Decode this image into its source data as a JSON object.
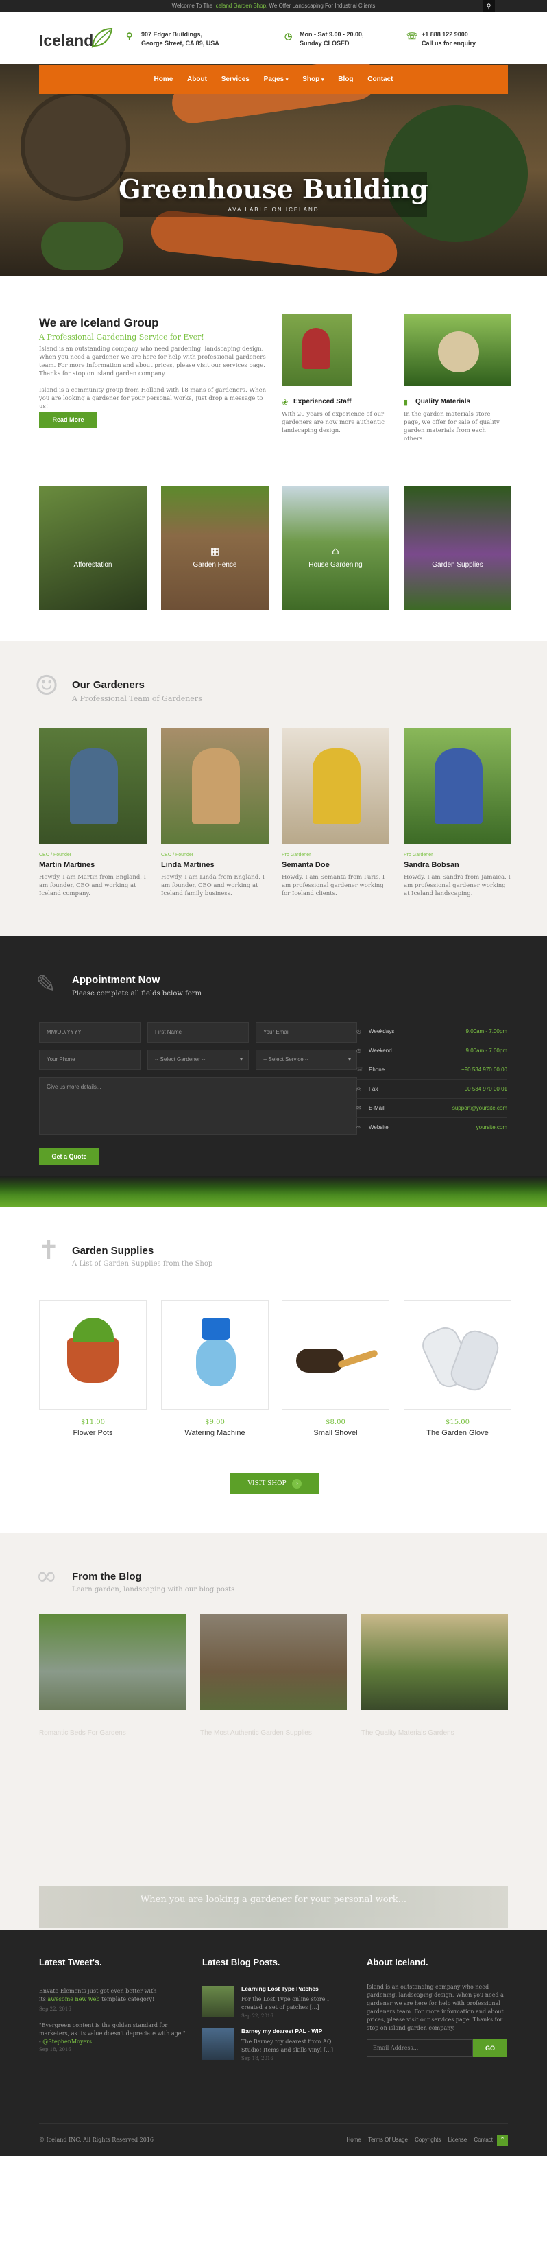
{
  "topbar": {
    "pre": "Welcome To The ",
    "link": "Iceland Garden Shop.",
    "post": " We Offer Landscaping For Industrial Clients",
    "search_icon": "search-icon"
  },
  "header": {
    "logo": "Iceland",
    "address_line1": "907 Edgar Buildings,",
    "address_line2": "George Street, CA 89, USA",
    "hours_line1": "Mon - Sat 9.00 - 20.00,",
    "hours_line2": "Sunday CLOSED",
    "phone_line1": "+1 888 122 9000",
    "phone_line2": "Call us for enquiry"
  },
  "nav": {
    "items": [
      "Home",
      "About",
      "Services",
      "Pages",
      "Shop",
      "Blog",
      "Contact"
    ]
  },
  "hero": {
    "title": "Greenhouse Building",
    "subtitle": "AVAILABLE ON ICELAND"
  },
  "about": {
    "heading": "We are Iceland Group",
    "tagline": "A Professional Gardening Service for Ever!",
    "para1": "Island is an outstanding company who need gardening, landscaping design. When you need a gardener we are here for help with professional gardeners team. For more information and about prices, please visit our services page. Thanks for stop on island garden company.",
    "para2": "Island is a community group from Holland with 18 mans of gardeners. When you are looking a gardener for your personal works, Just drop a message to us!",
    "button": "Read More",
    "features": [
      {
        "title": "Experienced Staff",
        "text": "With 20 years of experience of our gardeners are now more authentic landscaping design."
      },
      {
        "title": "Quality Materials",
        "text": "In the garden materials store page, we offer for sale of quality garden materials from each others."
      }
    ],
    "services": [
      "Afforestation",
      "Garden Fence",
      "House Gardening",
      "Garden Supplies"
    ]
  },
  "gardeners": {
    "heading": "Our Gardeners",
    "sub": "A Professional Team of Gardeners",
    "members": [
      {
        "role": "CEO / Founder",
        "name": "Martin Martines",
        "bio": "Howdy, I am Martin from England, I am founder, CEO and working at Iceland company."
      },
      {
        "role": "CEO / Founder",
        "name": "Linda Martines",
        "bio": "Howdy, I am Linda from England, I am founder, CEO and working at Iceland family business."
      },
      {
        "role": "Pro Gardener",
        "name": "Semanta Doe",
        "bio": "Howdy, I am Semanta from Paris, I am professional gardener working for Iceland clients."
      },
      {
        "role": "Pro Gardener",
        "name": "Sandra Bobsan",
        "bio": "Howdy, I am Sandra from Jamaica, I am professional gardener working at Iceland landscaping."
      }
    ]
  },
  "appointment": {
    "heading": "Appointment Now",
    "sub": "Please complete all fields below form",
    "fields": {
      "date": "MM/DD/YYYY",
      "first": "First Name",
      "email": "Your Email",
      "phone": "Your Phone",
      "gardener": "-- Select Gardener --",
      "service": "-- Select Service --",
      "message": "Give us more details..."
    },
    "button": "Get a Quote",
    "contact": [
      {
        "label": "Weekdays",
        "value": "9.00am - 7.00pm"
      },
      {
        "label": "Weekend",
        "value": "9.00am - 7.00pm"
      },
      {
        "label": "Phone",
        "value": "+90 534 970 00 00"
      },
      {
        "label": "Fax",
        "value": "+90 534 970 00 01"
      },
      {
        "label": "E-Mail",
        "value": "support@yoursite.com"
      },
      {
        "label": "Website",
        "value": "yoursite.com"
      }
    ]
  },
  "shop": {
    "heading": "Garden Supplies",
    "sub": "A List of Garden Supplies from the Shop",
    "products": [
      {
        "price": "$11.00",
        "name": "Flower Pots"
      },
      {
        "price": "$9.00",
        "name": "Watering Machine"
      },
      {
        "price": "$8.00",
        "name": "Small Shovel"
      },
      {
        "price": "$15.00",
        "name": "The Garden Glove"
      }
    ],
    "button": "VISIT SHOP"
  },
  "blog": {
    "heading": "From the Blog",
    "sub": "Learn garden, landscaping with our blog posts",
    "posts": [
      "Romantic Beds For Gardens",
      "The Most Authentic Garden Supplies",
      "The Quality Materials Gardens"
    ],
    "quote": "When you are looking a gardener for your personal work..."
  },
  "footer": {
    "tweets_heading": "Latest Tweet's.",
    "tweet1_pre": "Envato Elements just got even better with its ",
    "tweet1_link": "awesome new web",
    "tweet1_post": " template category!",
    "tweet1_date": "Sep 22, 2016",
    "tweet2_text": "\"Evergreen content is the golden standard for marketers, as its value doesn't depreciate with age.\" -",
    "tweet2_link": "@StephenMoyers",
    "tweet2_date": "Sep 18, 2016",
    "posts_heading": "Latest Blog Posts.",
    "post1_title": "Learning Lost Type Patches",
    "post1_text": "For the Lost Type online store I created a set of patches [...]",
    "post1_date": "Sep 22, 2016",
    "post2_title": "Barney my dearest PAL - WIP",
    "post2_text": "The Barney toy dearest from AQ Studio! Items and skills vinyl [...]",
    "post2_date": "Sep 18, 2016",
    "about_heading": "About Iceland.",
    "about_text": "Island is an outstanding company who need gardening, landscaping design. When you need a gardener we are here for help with professional gardeners team. For more information and about prices, please visit our services page. Thanks for stop on island garden company.",
    "email_placeholder": "Email Address...",
    "go": "GO",
    "copyright": "© Iceland INC. All Rights Reserved 2016",
    "links": [
      "Home",
      "Terms Of Usage",
      "Copyrights",
      "License",
      "Contact"
    ]
  },
  "colors": {
    "green": "#5ca028",
    "light_green": "#7cc244",
    "orange": "#e4690d",
    "dark": "#252525"
  }
}
